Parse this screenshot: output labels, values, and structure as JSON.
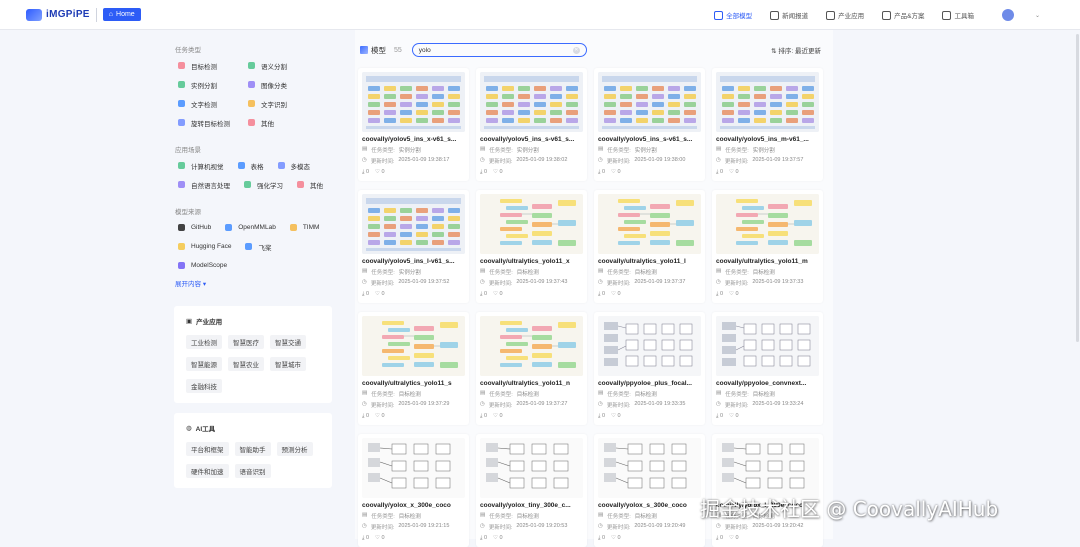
{
  "header": {
    "logo_text": "iMGPiPE",
    "home_label": "Home",
    "nav": [
      {
        "label": "全部模型",
        "icon": "model-icon",
        "active": true
      },
      {
        "label": "新闻报道",
        "icon": "news-icon"
      },
      {
        "label": "产业应用",
        "icon": "industry-icon"
      },
      {
        "label": "产品&方案",
        "icon": "product-icon"
      },
      {
        "label": "工具箱",
        "icon": "toolbox-icon"
      }
    ]
  },
  "sidebar": {
    "task_title": "任务类型",
    "tasks": [
      {
        "label": "目标检测",
        "color": "#f47c8c"
      },
      {
        "label": "语义分割",
        "color": "#4cc38a"
      },
      {
        "label": "实例分割",
        "color": "#4cc38a"
      },
      {
        "label": "图像分类",
        "color": "#8f7cf4"
      },
      {
        "label": "文字检测",
        "color": "#3f8cff"
      },
      {
        "label": "文字识别",
        "color": "#f5b642"
      },
      {
        "label": "旋转目标检测",
        "color": "#6f8cff"
      },
      {
        "label": "其他",
        "color": "#f47c8c"
      }
    ],
    "scene_title": "应用场景",
    "scenes": [
      {
        "label": "计算机视觉",
        "color": "#4cc38a"
      },
      {
        "label": "表格",
        "color": "#3f8cff"
      },
      {
        "label": "多模态",
        "color": "#6f8cff"
      },
      {
        "label": "自然语言处理",
        "color": "#8f7cf4"
      },
      {
        "label": "强化学习",
        "color": "#4cc38a"
      },
      {
        "label": "其他",
        "color": "#f47c8c"
      }
    ],
    "source_title": "模型来源",
    "sources": [
      {
        "label": "GitHub",
        "color": "#222222"
      },
      {
        "label": "OpenMMLab",
        "color": "#3f8cff"
      },
      {
        "label": "TIMM",
        "color": "#f5b642"
      },
      {
        "label": "Hugging Face",
        "color": "#f5c542"
      },
      {
        "label": "飞桨",
        "color": "#3f8cff"
      },
      {
        "label": "ModelScope",
        "color": "#6f5cf4"
      }
    ],
    "expand_label": "展开内容",
    "industry": {
      "title": "产业应用",
      "tags": [
        "工业检测",
        "智慧医疗",
        "智慧交通",
        "智慧能源",
        "智慧农业",
        "智慧城市",
        "金融科技"
      ]
    },
    "ai_tools": {
      "title": "AI工具",
      "tags": [
        "平台和框架",
        "智能助手",
        "预测分析",
        "硬件和加速",
        "语音识别"
      ]
    }
  },
  "main": {
    "title": "模型",
    "count": "55",
    "search_value": "yolo",
    "sort_label": "排序: 最近更新",
    "task_key": "任务类型:",
    "time_key": "更新时间:",
    "cards": [
      {
        "title": "coovally/yolov5_ins_x-v61_s...",
        "task": "实例分割",
        "time": "2025-01-09 19:38:17",
        "downloads": "0",
        "likes": "0",
        "thumb": "yolo"
      },
      {
        "title": "coovally/yolov5_ins_s-v61_s...",
        "task": "实例分割",
        "time": "2025-01-09 19:38:02",
        "downloads": "0",
        "likes": "0",
        "thumb": "yolo"
      },
      {
        "title": "coovally/yolov5_ins_s-v61_s...",
        "task": "实例分割",
        "time": "2025-01-09 19:38:00",
        "downloads": "0",
        "likes": "0",
        "thumb": "yolo"
      },
      {
        "title": "coovally/yolov5_ins_m-v61_...",
        "task": "实例分割",
        "time": "2025-01-09 19:37:57",
        "downloads": "0",
        "likes": "0",
        "thumb": "yolo"
      },
      {
        "title": "coovally/yolov5_ins_l-v61_s...",
        "task": "实例分割",
        "time": "2025-01-09 19:37:52",
        "downloads": "0",
        "likes": "0",
        "thumb": "yolo"
      },
      {
        "title": "coovally/ultralytics_yolo11_x",
        "task": "目标检测",
        "time": "2025-01-09 19:37:43",
        "downloads": "0",
        "likes": "0",
        "thumb": "ultra"
      },
      {
        "title": "coovally/ultralytics_yolo11_l",
        "task": "目标检测",
        "time": "2025-01-09 19:37:37",
        "downloads": "0",
        "likes": "0",
        "thumb": "ultra"
      },
      {
        "title": "coovally/ultralytics_yolo11_m",
        "task": "目标检测",
        "time": "2025-01-09 19:37:33",
        "downloads": "0",
        "likes": "0",
        "thumb": "ultra"
      },
      {
        "title": "coovally/ultralytics_yolo11_s",
        "task": "目标检测",
        "time": "2025-01-09 19:37:29",
        "downloads": "0",
        "likes": "0",
        "thumb": "ultra"
      },
      {
        "title": "coovally/ultralytics_yolo11_n",
        "task": "目标检测",
        "time": "2025-01-09 19:37:27",
        "downloads": "0",
        "likes": "0",
        "thumb": "ultra"
      },
      {
        "title": "coovally/ppyoloe_plus_focal...",
        "task": "目标检测",
        "time": "2025-01-09 19:33:35",
        "downloads": "0",
        "likes": "0",
        "thumb": "pp"
      },
      {
        "title": "coovally/ppyoloe_convnext...",
        "task": "目标检测",
        "time": "2025-01-09 19:33:24",
        "downloads": "0",
        "likes": "0",
        "thumb": "pp"
      },
      {
        "title": "coovally/yolox_x_300e_coco",
        "task": "目标检测",
        "time": "2025-01-09 19:21:15",
        "downloads": "0",
        "likes": "0",
        "thumb": "x"
      },
      {
        "title": "coovally/yolox_tiny_300e_c...",
        "task": "目标检测",
        "time": "2025-01-09 19:20:53",
        "downloads": "0",
        "likes": "0",
        "thumb": "x"
      },
      {
        "title": "coovally/yolox_s_300e_coco",
        "task": "目标检测",
        "time": "2025-01-09 19:20:49",
        "downloads": "0",
        "likes": "0",
        "thumb": "x"
      },
      {
        "title": "coovally/yolox_l_300e_coco",
        "task": "目标检测",
        "time": "2025-01-09 19:20:42",
        "downloads": "0",
        "likes": "0",
        "thumb": "x"
      }
    ]
  },
  "watermark": "掘金技术社区 @ CoovallyAIHub"
}
